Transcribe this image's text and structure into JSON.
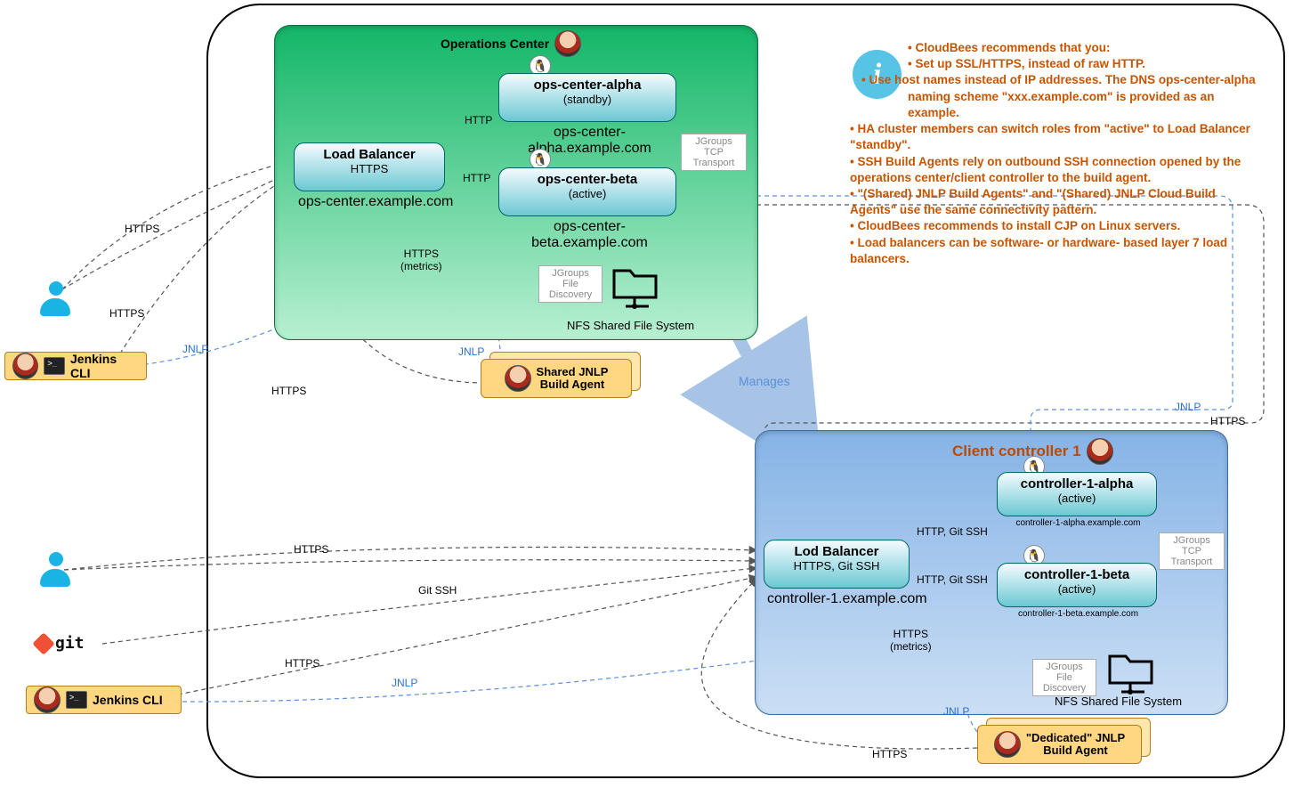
{
  "outer": {},
  "panel_ops": {
    "title": "Operations Center",
    "lb": {
      "title": "Load Balancer",
      "sub": "HTTPS",
      "url": "ops-center.example.com"
    },
    "alpha": {
      "title": "ops-center-alpha",
      "sub": "(standby)",
      "url": "ops-center-alpha.example.com"
    },
    "beta": {
      "title": "ops-center-beta",
      "sub": "(active)",
      "url": "ops-center-beta.example.com"
    },
    "jgroups_tcp": "JGroups TCP Transport",
    "jgroups_file": "JGroups File Discovery",
    "nfs": "NFS Shared File System"
  },
  "panel_client": {
    "title": "Client controller 1",
    "lb": {
      "title": "Lod Balancer",
      "sub": "HTTPS, Git SSH",
      "url": "controller-1.example.com"
    },
    "alpha": {
      "title": "controller-1-alpha",
      "sub": "(active)",
      "url": "controller-1-alpha.example.com"
    },
    "beta": {
      "title": "controller-1-beta",
      "sub": "(active)",
      "url": "controller-1-beta.example.com"
    },
    "jgroups_tcp": "JGroups TCP Transport",
    "jgroups_file": "JGroups File Discovery",
    "nfs": "NFS Shared File System"
  },
  "agents": {
    "shared": "Shared JNLP Build Agent",
    "dedicated": "\"Dedicated\" JNLP Build Agent"
  },
  "cli": {
    "jenkins1": "Jenkins CLI",
    "jenkins2": "Jenkins CLI"
  },
  "git_label": "git",
  "manages": "Manages",
  "info_bullets": [
    "• CloudBees recommends that you:",
    "   • Set up SSL/HTTPS, instead of raw HTTP.",
    "   • Use host names instead of IP addresses. The DNS ops-center-alpha naming scheme \"xxx.example.com\" is provided as an example.",
    "• HA cluster members can switch roles from \"active\" to Load Balancer \"standby\".",
    "• SSH Build Agents rely on outbound SSH connection opened by the operations center/client controller to the build agent.",
    "• \"(Shared) JNLP Build Agents\" and \"(Shared) JNLP Cloud Build Agents\" use the same connectivity pattern.",
    "• CloudBees recommends to install CJP on Linux servers.",
    "• Load balancers can be software- or hardware- based layer 7 load balancers."
  ],
  "edge_labels": {
    "https": "HTTPS",
    "http": "HTTP",
    "https_metrics": "HTTPS\n(metrics)",
    "jnlp": "JNLP",
    "git_ssh": "Git SSH",
    "http_gitssh": "HTTP, Git SSH"
  }
}
